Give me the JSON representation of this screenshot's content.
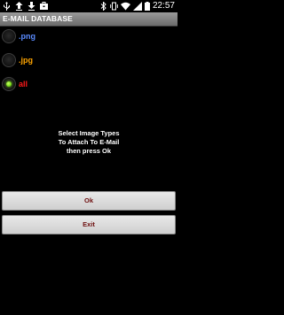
{
  "status_bar": {
    "left_icons": [
      "usb-icon",
      "upload-icon",
      "download-icon",
      "briefcase-icon"
    ],
    "right_icons": [
      "bluetooth-icon",
      "vibrate-icon",
      "wifi-icon",
      "signal-icon",
      "battery-icon"
    ],
    "time": "22:57"
  },
  "header": {
    "title": "E-MAIL DATABASE"
  },
  "options": [
    {
      "label": ".png",
      "color": "#5b8cff",
      "selected": false
    },
    {
      "label": ".jpg",
      "color": "#ffa500",
      "selected": false
    },
    {
      "label": "all",
      "color": "#ff1a1a",
      "selected": true
    }
  ],
  "instructions": {
    "line1": "Select Image Types",
    "line2": "To Attach To E-Mail",
    "line3": "then press Ok"
  },
  "buttons": {
    "ok": "Ok",
    "exit": "Exit"
  },
  "colors": {
    "button_text": "#6e0f0f",
    "radio_selected": "#7ee21a"
  }
}
